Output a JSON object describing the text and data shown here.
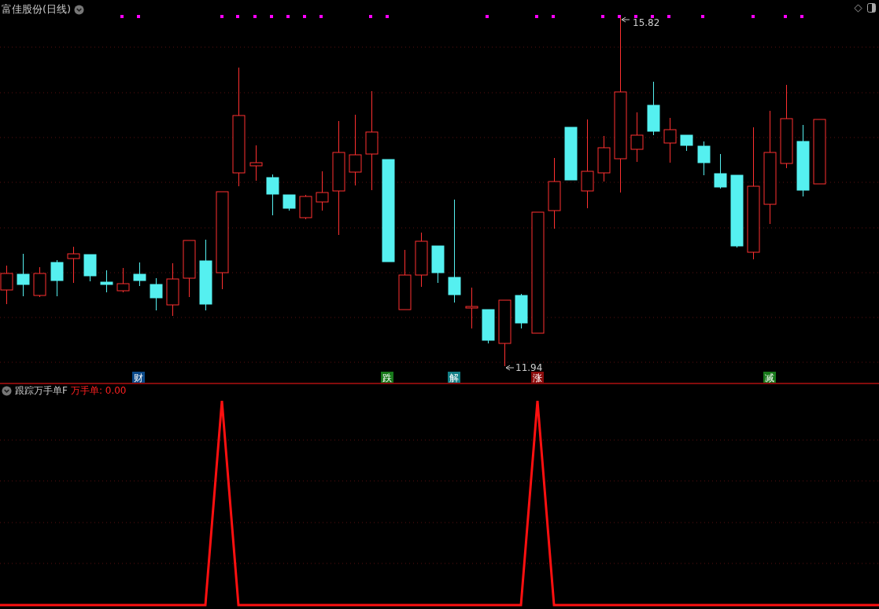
{
  "title": "富佳股份(日线)",
  "price_labels": [
    {
      "kind": "high",
      "text": "15.82"
    },
    {
      "kind": "low",
      "text": "11.94"
    }
  ],
  "markers": [
    {
      "label": "财",
      "color": "#0b4a8a"
    },
    {
      "label": "跌",
      "color": "#17781a"
    },
    {
      "label": "解",
      "color": "#127f86"
    },
    {
      "label": "涨",
      "color": "#8a0b0b"
    },
    {
      "label": "减",
      "color": "#17781a"
    }
  ],
  "indicator": {
    "name": "跟踪万手单F",
    "reading": "万手单: 0.00"
  }
}
